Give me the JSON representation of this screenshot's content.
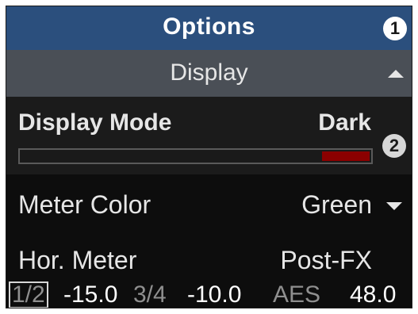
{
  "header": {
    "title": "Options",
    "badge": "1"
  },
  "section": {
    "title": "Display",
    "icon": "chevron-up-icon"
  },
  "display_mode": {
    "label": "Display Mode",
    "value": "Dark",
    "badge": "2",
    "slider_level": 0.14,
    "slider_color": "#8b0000"
  },
  "meter_color": {
    "label": "Meter Color",
    "value": "Green",
    "icon": "chevron-down-icon"
  },
  "hor_meter": {
    "label": "Hor. Meter",
    "value": "Post-FX"
  },
  "status_bar": {
    "ch1_label": "1/2",
    "ch1_value": "-15.0",
    "ch2_label": "3/4",
    "ch2_value": "-10.0",
    "aes_label": "AES",
    "aes_value": "48.0"
  },
  "colors": {
    "header_bg": "#2b4f7d",
    "section_bg": "#4a4f56",
    "panel_bg": "#0d0d0d",
    "accent_red": "#8b0000"
  }
}
